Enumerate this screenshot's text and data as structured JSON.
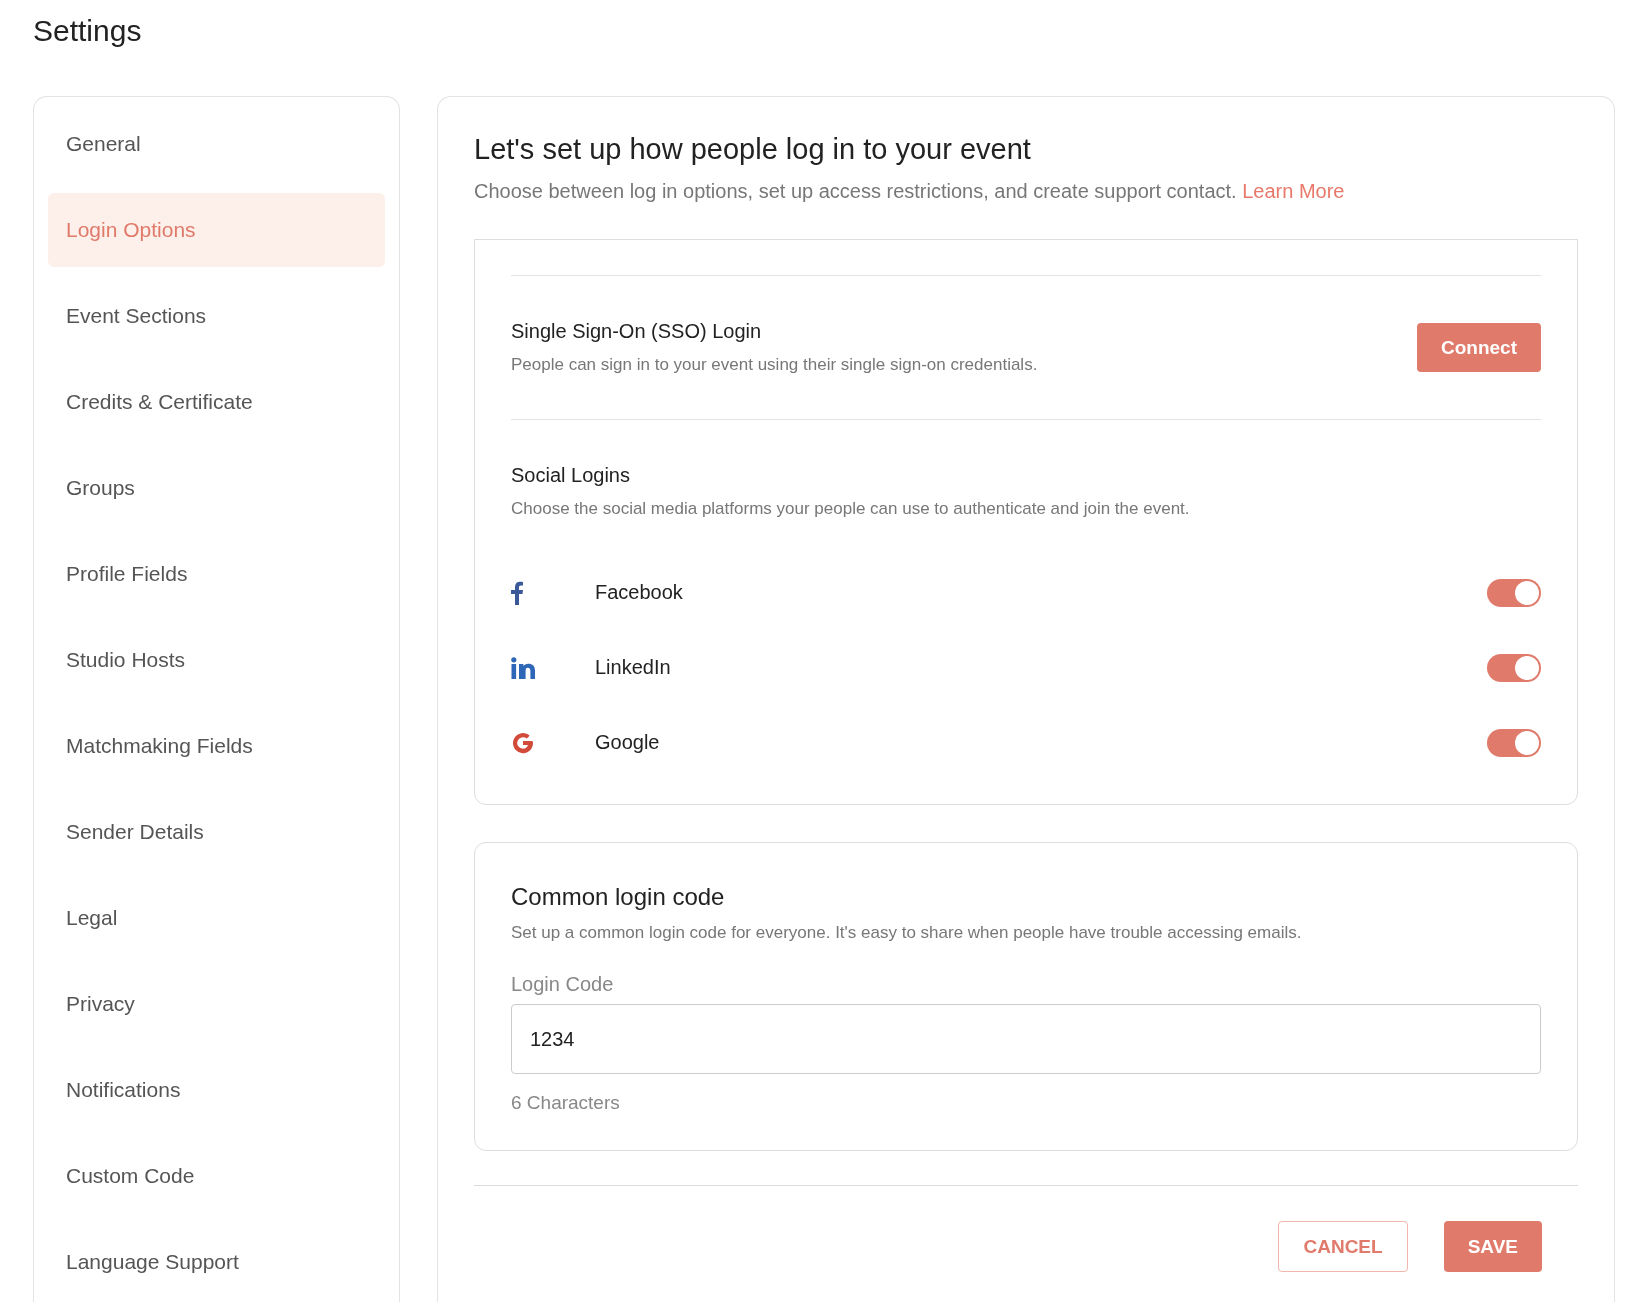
{
  "page_title": "Settings",
  "sidebar": {
    "items": [
      {
        "label": "General",
        "selected": false
      },
      {
        "label": "Login Options",
        "selected": true
      },
      {
        "label": "Event Sections",
        "selected": false
      },
      {
        "label": "Credits & Certificate",
        "selected": false
      },
      {
        "label": "Groups",
        "selected": false
      },
      {
        "label": "Profile Fields",
        "selected": false
      },
      {
        "label": "Studio Hosts",
        "selected": false
      },
      {
        "label": "Matchmaking Fields",
        "selected": false
      },
      {
        "label": "Sender Details",
        "selected": false
      },
      {
        "label": "Legal",
        "selected": false
      },
      {
        "label": "Privacy",
        "selected": false
      },
      {
        "label": "Notifications",
        "selected": false
      },
      {
        "label": "Custom Code",
        "selected": false
      },
      {
        "label": "Language Support",
        "selected": false
      }
    ]
  },
  "main": {
    "heading": "Let's set up how people log in to your event",
    "subtitle": "Choose between log in options, set up access restrictions, and create support contact.",
    "link": "Learn More",
    "sso": {
      "title": "Single Sign-On (SSO) Login",
      "description": "People can sign in to your event using their single sign-on credentials.",
      "button": "Connect"
    },
    "social": {
      "title": "Social Logins",
      "description": "Choose the social media platforms your people can use to authenticate and join the event.",
      "providers": [
        {
          "kind": "facebook",
          "name": "Facebook",
          "on": true
        },
        {
          "kind": "linkedin",
          "name": "LinkedIn",
          "on": true
        },
        {
          "kind": "google",
          "name": "Google",
          "on": true
        }
      ]
    },
    "common_code": {
      "title": "Common login code",
      "description": "Set up a common login code for everyone. It's easy to share when people have trouble accessing emails.",
      "field_label": "Login Code",
      "value": "1234",
      "hint": "6 Characters"
    },
    "buttons": {
      "cancel": "CANCEL",
      "save": "SAVE"
    }
  }
}
